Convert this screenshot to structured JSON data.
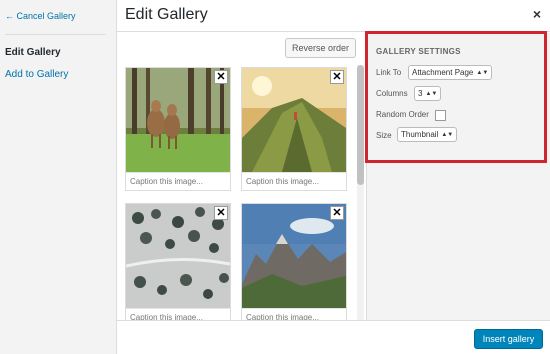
{
  "menu": {
    "cancel_label": "← Cancel Gallery",
    "active_label": "Edit Gallery",
    "add_label": "Add to Gallery"
  },
  "header": {
    "title": "Edit Gallery",
    "close_glyph": "×"
  },
  "toolbar_top": {
    "reverse_label": "Reverse order"
  },
  "gallery": {
    "items": [
      {
        "caption": "Caption this image...",
        "image": "deer-in-forest"
      },
      {
        "caption": "Caption this image...",
        "image": "mountain-ridge-hiker"
      },
      {
        "caption": "Caption this image...",
        "image": "snowy-forest-aerial"
      },
      {
        "caption": "Caption this image...",
        "image": "rocky-mountains"
      }
    ],
    "remove_glyph": "✕"
  },
  "settings": {
    "title": "GALLERY SETTINGS",
    "link_to_label": "Link To",
    "link_to_value": "Attachment Page",
    "columns_label": "Columns",
    "columns_value": "3",
    "random_label": "Random Order",
    "random_checked": false,
    "size_label": "Size",
    "size_value": "Thumbnail"
  },
  "footer": {
    "insert_label": "Insert gallery"
  },
  "colors": {
    "accent": "#0085ba",
    "link": "#0073aa",
    "highlight": "#d0252d"
  }
}
